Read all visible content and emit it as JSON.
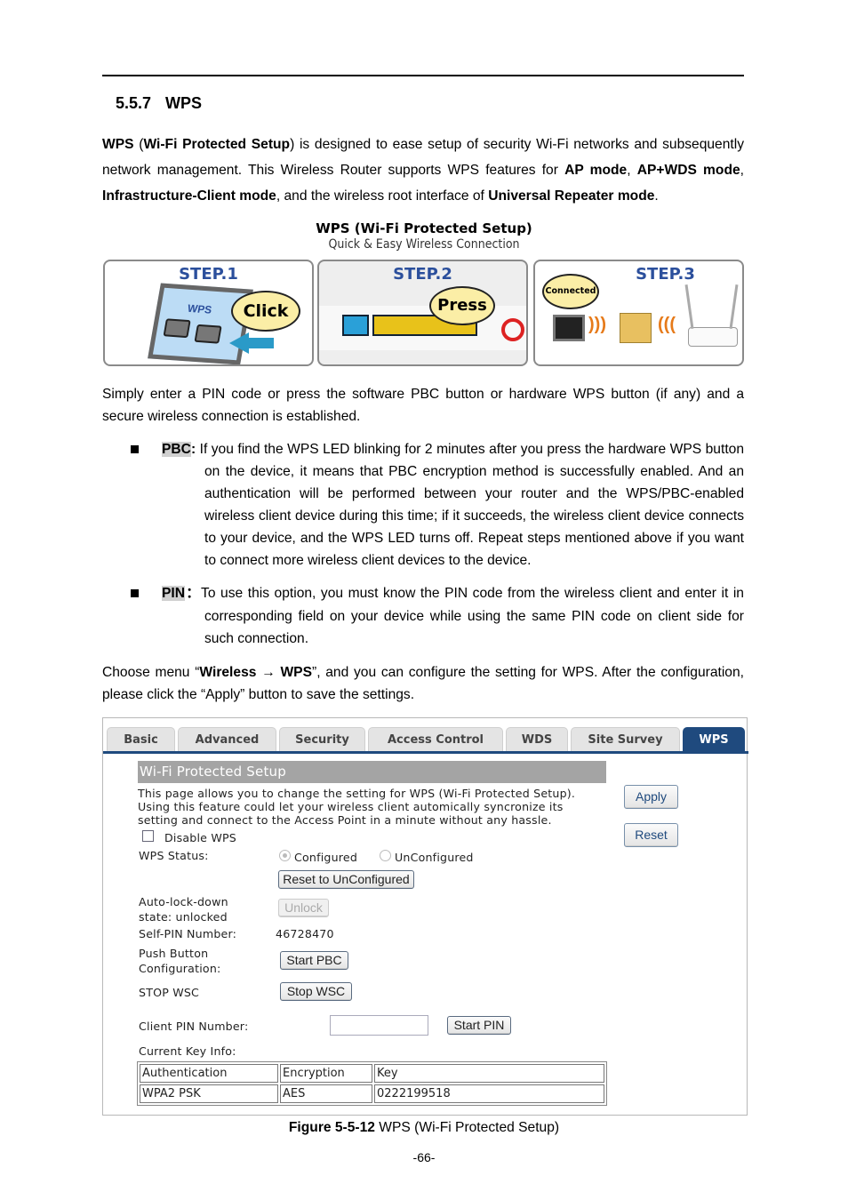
{
  "section": {
    "number": "5.5.7",
    "title": "WPS"
  },
  "intro": {
    "b1": "WPS",
    "t1": " (",
    "b2": "Wi-Fi Protected Setup",
    "t2": ") is designed to ease setup of security Wi-Fi networks and subsequently network management. This Wireless Router supports WPS features for ",
    "b3": "AP mode",
    "t3": ", ",
    "b4": "AP+WDS mode",
    "t4": ", ",
    "b5": "Infrastructure-Client mode",
    "t5": ", and the wireless root interface of ",
    "b6": "Universal Repeater mode",
    "t6": "."
  },
  "illustration": {
    "title": "WPS (Wi-Fi Protected Setup)",
    "subtitle": "Quick & Easy Wireless Connection",
    "steps": [
      {
        "label": "STEP.1",
        "bubble": "Click",
        "screen_text": "WPS"
      },
      {
        "label": "STEP.2",
        "bubble": "Press"
      },
      {
        "label": "STEP.3",
        "bubble": "Connected"
      }
    ]
  },
  "para2": "Simply enter a PIN code or press the software PBC button or hardware WPS button (if any) and a secure wireless connection is established.",
  "bullets": [
    {
      "term": "PBC",
      "sep": ":",
      "text": " If you find the WPS LED blinking for 2 minutes after you press the hardware WPS button on the device, it means that PBC encryption method is successfully enabled. And an authentication will be performed between your router and the WPS/PBC-enabled wireless client device during this time; if it succeeds, the wireless client device connects to your device, and the WPS LED turns off. Repeat steps mentioned above if you want to connect more wireless client devices to the device."
    },
    {
      "term": "PIN",
      "sep": "：",
      "text": "To use this option, you must know the PIN code from the wireless client and enter it in corresponding field on your device while using the same PIN code on client side for such connection."
    }
  ],
  "para3": {
    "t1": "Choose menu “",
    "b1": "Wireless",
    "arrow": " → ",
    "b2": "WPS",
    "t2": "”, and you can configure the setting for WPS. After the configuration, please click the “Apply” button to save the settings."
  },
  "screenshot": {
    "tabs": [
      "Basic",
      "Advanced",
      "Security",
      "Access Control",
      "WDS",
      "Site Survey",
      "WPS"
    ],
    "active_tab": "WPS",
    "header": "Wi-Fi Protected Setup",
    "description": [
      "This page allows you to change the setting for WPS (Wi-Fi Protected Setup).",
      "Using this feature could let your wireless client automically syncronize its",
      "setting and connect to the Access Point in a minute without any hassle."
    ],
    "apply": "Apply",
    "reset": "Reset",
    "disable_wps": "Disable WPS",
    "disable_wps_checked": false,
    "wps_status_label": "WPS Status:",
    "status_options": [
      "Configured",
      "UnConfigured"
    ],
    "status_selected": "Configured",
    "reset_unconfigured": "Reset to UnConfigured",
    "autolock_label": [
      "Auto-lock-down",
      "state: unlocked"
    ],
    "unlock": "Unlock",
    "self_pin_label": "Self-PIN Number:",
    "self_pin": "46728470",
    "pbc_label": [
      "Push Button",
      "Configuration:"
    ],
    "start_pbc": "Start PBC",
    "stop_label": "STOP WSC",
    "stop_wsc": "Stop WSC",
    "client_pin_label": "Client PIN Number:",
    "client_pin_value": "",
    "start_pin": "Start PIN",
    "key_info_label": "Current Key Info:",
    "key_table": {
      "headers": [
        "Authentication",
        "Encryption",
        "Key"
      ],
      "rows": [
        [
          "WPA2 PSK",
          "AES",
          "0222199518"
        ]
      ]
    },
    "colors": {
      "tab_active": "#1f4a7e",
      "header_bar": "#a4a4a4"
    }
  },
  "caption": {
    "label": "Figure 5-5-12",
    "text": " WPS (Wi-Fi Protected Setup)"
  },
  "page_number": "-66-"
}
